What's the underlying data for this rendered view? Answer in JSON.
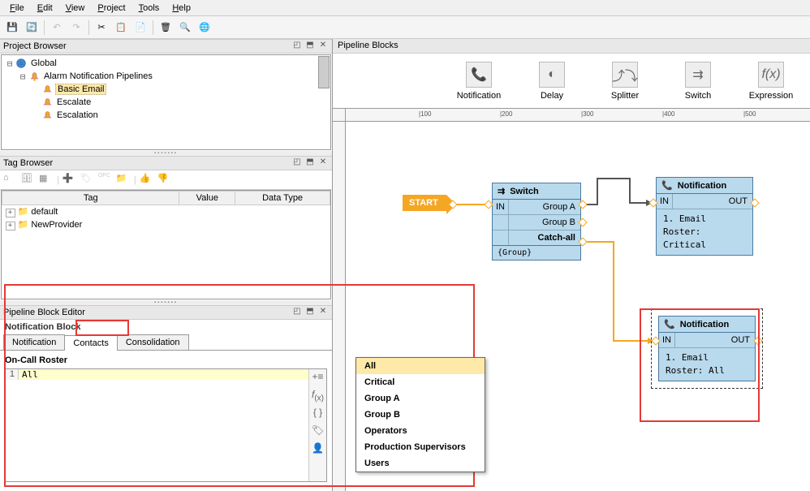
{
  "menu": [
    "File",
    "Edit",
    "View",
    "Project",
    "Tools",
    "Help"
  ],
  "panels": {
    "project_browser": "Project Browser",
    "tag_browser": "Tag Browser",
    "block_editor": "Pipeline Block Editor",
    "pipeline_blocks": "Pipeline Blocks"
  },
  "project_tree": {
    "root": "Global",
    "folder": "Alarm Notification Pipelines",
    "items": [
      "Basic Email",
      "Escalate",
      "Escalation"
    ]
  },
  "tag_browser": {
    "columns": [
      "Tag",
      "Value",
      "Data Type"
    ],
    "rows": [
      "default",
      "NewProvider"
    ]
  },
  "block_editor": {
    "subtitle": "Notification Block",
    "tabs": [
      "Notification",
      "Contacts",
      "Consolidation"
    ],
    "roster_label": "On-Call Roster",
    "roster_value": "All"
  },
  "palette": [
    "Notification",
    "Delay",
    "Splitter",
    "Switch",
    "Expression"
  ],
  "canvas": {
    "start": "START",
    "switch": {
      "title": "Switch",
      "in": "IN",
      "outputs": [
        "Group A",
        "Group B",
        "Catch-all"
      ],
      "expr": "{Group}"
    },
    "notif1": {
      "title": "Notification",
      "in": "IN",
      "out": "OUT",
      "line1": "1. Email",
      "line2": "Roster: Critical"
    },
    "notif2": {
      "title": "Notification",
      "in": "IN",
      "out": "OUT",
      "line1": "1. Email",
      "line2": "Roster: All"
    }
  },
  "dropdown": [
    "All",
    "Critical",
    "Group A",
    "Group B",
    "Operators",
    "Production Supervisors",
    "Users"
  ],
  "ruler_marks": [
    100,
    200,
    300,
    400,
    500
  ]
}
